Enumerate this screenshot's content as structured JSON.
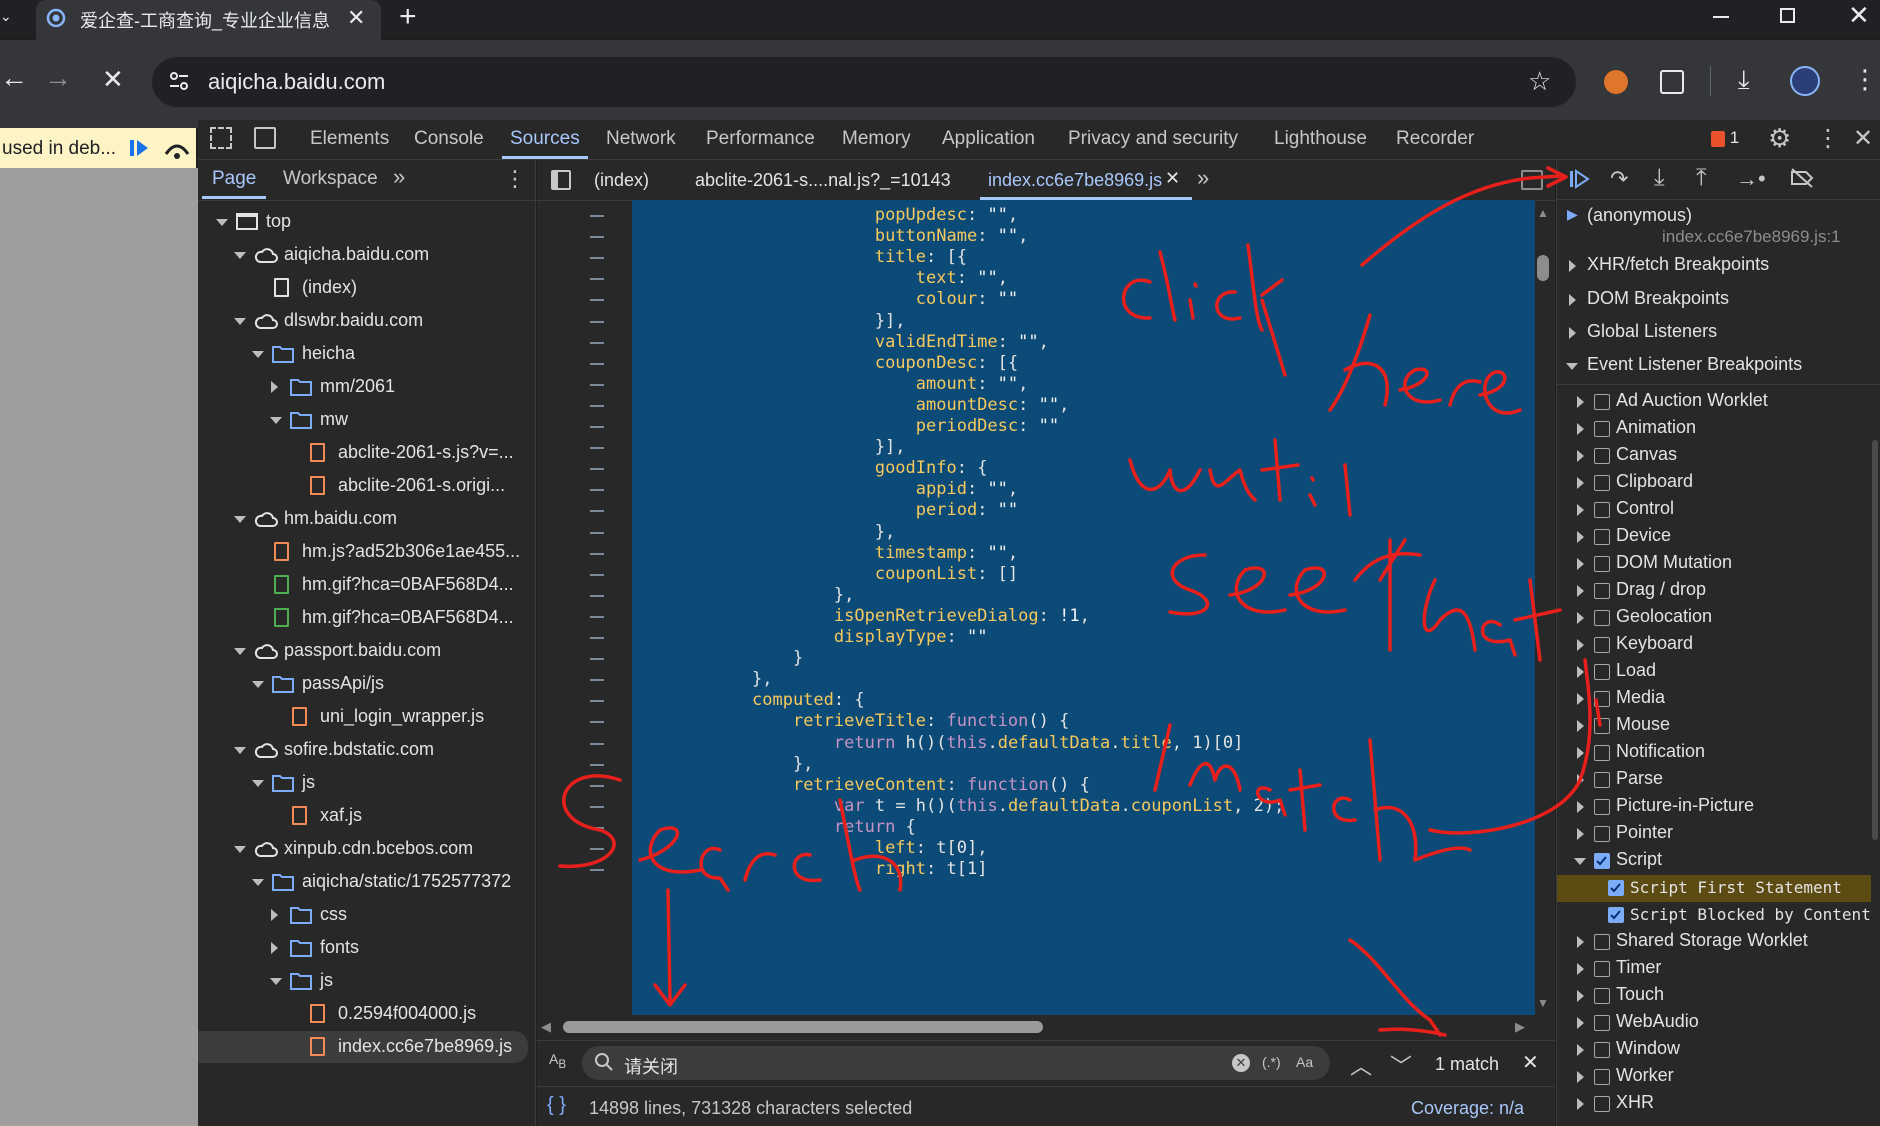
{
  "browser": {
    "tab_title": "爱企查-工商查询_专业企业信息",
    "url": "aiqicha.baidu.com"
  },
  "paused_banner": "used in deb...",
  "devtools_tabs": [
    "Elements",
    "Console",
    "Sources",
    "Network",
    "Performance",
    "Memory",
    "Application",
    "Privacy and security",
    "Lighthouse",
    "Recorder"
  ],
  "issues_count": "1",
  "navigator": {
    "tabs": [
      "Page",
      "Workspace"
    ],
    "tree": [
      {
        "label": "top",
        "depth": 0,
        "type": "frame",
        "open": true
      },
      {
        "label": "aiqicha.baidu.com",
        "depth": 1,
        "type": "cloud",
        "open": true
      },
      {
        "label": "(index)",
        "depth": 2,
        "type": "doc"
      },
      {
        "label": "dlswbr.baidu.com",
        "depth": 1,
        "type": "cloud",
        "open": true
      },
      {
        "label": "heicha",
        "depth": 2,
        "type": "folder",
        "open": true
      },
      {
        "label": "mm/2061",
        "depth": 3,
        "type": "folder",
        "open": false
      },
      {
        "label": "mw",
        "depth": 3,
        "type": "folder",
        "open": true
      },
      {
        "label": "abclite-2061-s.js?v=...",
        "depth": 4,
        "type": "js"
      },
      {
        "label": "abclite-2061-s.origi...",
        "depth": 4,
        "type": "js"
      },
      {
        "label": "hm.baidu.com",
        "depth": 1,
        "type": "cloud",
        "open": true
      },
      {
        "label": "hm.js?ad52b306e1ae455...",
        "depth": 2,
        "type": "js"
      },
      {
        "label": "hm.gif?hca=0BAF568D4...",
        "depth": 2,
        "type": "img"
      },
      {
        "label": "hm.gif?hca=0BAF568D4...",
        "depth": 2,
        "type": "img"
      },
      {
        "label": "passport.baidu.com",
        "depth": 1,
        "type": "cloud",
        "open": true
      },
      {
        "label": "passApi/js",
        "depth": 2,
        "type": "folder",
        "open": true
      },
      {
        "label": "uni_login_wrapper.js",
        "depth": 3,
        "type": "js"
      },
      {
        "label": "sofire.bdstatic.com",
        "depth": 1,
        "type": "cloud",
        "open": true
      },
      {
        "label": "js",
        "depth": 2,
        "type": "folder",
        "open": true
      },
      {
        "label": "xaf.js",
        "depth": 3,
        "type": "js"
      },
      {
        "label": "xinpub.cdn.bcebos.com",
        "depth": 1,
        "type": "cloud",
        "open": true
      },
      {
        "label": "aiqicha/static/1752577372",
        "depth": 2,
        "type": "folder",
        "open": true
      },
      {
        "label": "css",
        "depth": 3,
        "type": "folder",
        "open": false
      },
      {
        "label": "fonts",
        "depth": 3,
        "type": "folder",
        "open": false
      },
      {
        "label": "js",
        "depth": 3,
        "type": "folder",
        "open": true
      },
      {
        "label": "0.2594f004000.js",
        "depth": 4,
        "type": "js"
      },
      {
        "label": "index.cc6e7be8969.js",
        "depth": 4,
        "type": "js",
        "selected": true
      }
    ]
  },
  "editor": {
    "tabs": [
      "(index)",
      "abclite-2061-s....nal.js?_=10143",
      "index.cc6e7be8969.js"
    ],
    "code": [
      [
        {
          "t": "            "
        },
        {
          "c": "p",
          "t": "popUpdesc"
        },
        {
          "t": ": "
        },
        {
          "c": "s",
          "t": "\"\""
        },
        {
          "t": ","
        }
      ],
      [
        {
          "t": "            "
        },
        {
          "c": "p",
          "t": "buttonName"
        },
        {
          "t": ": "
        },
        {
          "c": "s",
          "t": "\"\""
        },
        {
          "t": ","
        }
      ],
      [
        {
          "t": "            "
        },
        {
          "c": "p",
          "t": "title"
        },
        {
          "t": ": [{"
        }
      ],
      [
        {
          "t": "                "
        },
        {
          "c": "p",
          "t": "text"
        },
        {
          "t": ": "
        },
        {
          "c": "s",
          "t": "\"\""
        },
        {
          "t": ","
        }
      ],
      [
        {
          "t": "                "
        },
        {
          "c": "p",
          "t": "colour"
        },
        {
          "t": ": "
        },
        {
          "c": "s",
          "t": "\"\""
        }
      ],
      [
        {
          "t": "            }],"
        }
      ],
      [
        {
          "t": "            "
        },
        {
          "c": "p",
          "t": "validEndTime"
        },
        {
          "t": ": "
        },
        {
          "c": "s",
          "t": "\"\""
        },
        {
          "t": ","
        }
      ],
      [
        {
          "t": "            "
        },
        {
          "c": "p",
          "t": "couponDesc"
        },
        {
          "t": ": [{"
        }
      ],
      [
        {
          "t": "                "
        },
        {
          "c": "p",
          "t": "amount"
        },
        {
          "t": ": "
        },
        {
          "c": "s",
          "t": "\"\""
        },
        {
          "t": ","
        }
      ],
      [
        {
          "t": "                "
        },
        {
          "c": "p",
          "t": "amountDesc"
        },
        {
          "t": ": "
        },
        {
          "c": "s",
          "t": "\"\""
        },
        {
          "t": ","
        }
      ],
      [
        {
          "t": "                "
        },
        {
          "c": "p",
          "t": "periodDesc"
        },
        {
          "t": ": "
        },
        {
          "c": "s",
          "t": "\"\""
        }
      ],
      [
        {
          "t": "            }],"
        }
      ],
      [
        {
          "t": "            "
        },
        {
          "c": "p",
          "t": "goodInfo"
        },
        {
          "t": ": {"
        }
      ],
      [
        {
          "t": "                "
        },
        {
          "c": "p",
          "t": "appid"
        },
        {
          "t": ": "
        },
        {
          "c": "s",
          "t": "\"\""
        },
        {
          "t": ","
        }
      ],
      [
        {
          "t": "                "
        },
        {
          "c": "p",
          "t": "period"
        },
        {
          "t": ": "
        },
        {
          "c": "s",
          "t": "\"\""
        }
      ],
      [
        {
          "t": "            },"
        }
      ],
      [
        {
          "t": "            "
        },
        {
          "c": "p",
          "t": "timestamp"
        },
        {
          "t": ": "
        },
        {
          "c": "s",
          "t": "\"\""
        },
        {
          "t": ","
        }
      ],
      [
        {
          "t": "            "
        },
        {
          "c": "p",
          "t": "couponList"
        },
        {
          "t": ": []"
        }
      ],
      [
        {
          "t": "        },"
        }
      ],
      [
        {
          "t": "        "
        },
        {
          "c": "p",
          "t": "isOpenRetrieveDialog"
        },
        {
          "t": ": "
        },
        {
          "c": "n",
          "t": "!1"
        },
        {
          "t": ","
        }
      ],
      [
        {
          "t": "        "
        },
        {
          "c": "p",
          "t": "displayType"
        },
        {
          "t": ": "
        },
        {
          "c": "s",
          "t": "\"\""
        }
      ],
      [
        {
          "t": "    }"
        }
      ],
      [
        {
          "t": "},"
        }
      ],
      [
        {
          "c": "p",
          "t": "computed"
        },
        {
          "t": ": {"
        }
      ],
      [
        {
          "t": "    "
        },
        {
          "c": "p",
          "t": "retrieveTitle"
        },
        {
          "t": ": "
        },
        {
          "c": "k",
          "t": "function"
        },
        {
          "t": "() {"
        }
      ],
      [
        {
          "t": "        "
        },
        {
          "c": "k",
          "t": "return"
        },
        {
          "t": " h()("
        },
        {
          "c": "k",
          "t": "this"
        },
        {
          "t": "."
        },
        {
          "c": "p",
          "t": "defaultData"
        },
        {
          "t": "."
        },
        {
          "c": "p",
          "t": "title"
        },
        {
          "t": ", 1)[0]"
        }
      ],
      [
        {
          "t": "    },"
        }
      ],
      [
        {
          "t": "    "
        },
        {
          "c": "p",
          "t": "retrieveContent"
        },
        {
          "t": ": "
        },
        {
          "c": "k",
          "t": "function"
        },
        {
          "t": "() {"
        }
      ],
      [
        {
          "t": "        "
        },
        {
          "c": "k",
          "t": "var"
        },
        {
          "t": " t = h()("
        },
        {
          "c": "k",
          "t": "this"
        },
        {
          "t": "."
        },
        {
          "c": "p",
          "t": "defaultData"
        },
        {
          "t": "."
        },
        {
          "c": "p",
          "t": "couponList"
        },
        {
          "t": ", 2);"
        }
      ],
      [
        {
          "t": "        "
        },
        {
          "c": "k",
          "t": "return"
        },
        {
          "t": " {"
        }
      ],
      [
        {
          "t": "            "
        },
        {
          "c": "p",
          "t": "left"
        },
        {
          "t": ": t[0],"
        }
      ],
      [
        {
          "t": "            "
        },
        {
          "c": "p",
          "t": "right"
        },
        {
          "t": ": t[1]"
        }
      ]
    ],
    "search_value": "请关闭",
    "match_text": "1 match",
    "status_text": "14898 lines, 731328 characters selected",
    "coverage": "Coverage: n/a"
  },
  "debugger": {
    "call_frame": "(anonymous)",
    "call_location": "index.cc6e7be8969.js:1",
    "sections": [
      "XHR/fetch Breakpoints",
      "DOM Breakpoints",
      "Global Listeners",
      "Event Listener Breakpoints"
    ],
    "event_categories": [
      {
        "label": "Ad Auction Worklet",
        "checked": false
      },
      {
        "label": "Animation",
        "checked": false
      },
      {
        "label": "Canvas",
        "checked": false
      },
      {
        "label": "Clipboard",
        "checked": false
      },
      {
        "label": "Control",
        "checked": false
      },
      {
        "label": "Device",
        "checked": false
      },
      {
        "label": "DOM Mutation",
        "checked": false
      },
      {
        "label": "Drag / drop",
        "checked": false
      },
      {
        "label": "Geolocation",
        "checked": false
      },
      {
        "label": "Keyboard",
        "checked": false
      },
      {
        "label": "Load",
        "checked": false
      },
      {
        "label": "Media",
        "checked": false
      },
      {
        "label": "Mouse",
        "checked": false
      },
      {
        "label": "Notification",
        "checked": false
      },
      {
        "label": "Parse",
        "checked": false
      },
      {
        "label": "Picture-in-Picture",
        "checked": false
      },
      {
        "label": "Pointer",
        "checked": false
      },
      {
        "label": "Script",
        "checked": true,
        "open": true
      },
      {
        "label": "Script First Statement",
        "checked": true,
        "sub": true,
        "highlight": true
      },
      {
        "label": "Script Blocked by Content Security Policy",
        "checked": true,
        "sub": true
      },
      {
        "label": "Shared Storage Worklet",
        "checked": false
      },
      {
        "label": "Timer",
        "checked": false
      },
      {
        "label": "Touch",
        "checked": false
      },
      {
        "label": "WebAudio",
        "checked": false
      },
      {
        "label": "Window",
        "checked": false
      },
      {
        "label": "Worker",
        "checked": false
      },
      {
        "label": "XHR",
        "checked": false
      }
    ]
  },
  "annotation_color": "#e8201c"
}
